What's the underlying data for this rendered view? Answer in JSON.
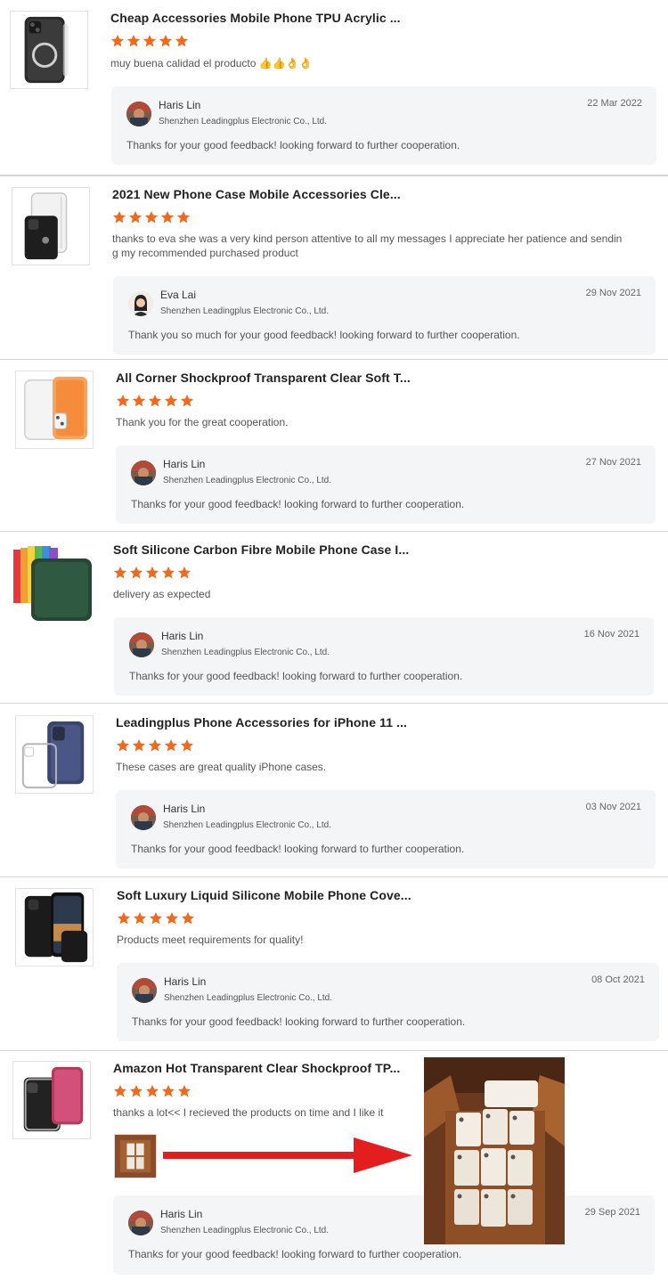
{
  "reviews": [
    {
      "title": "Cheap Accessories Mobile Phone TPU Acrylic ...",
      "comment": "muy buena calidad el producto 👍👍👌👌",
      "rating": 5,
      "reply": {
        "name": "Haris Lin",
        "company": "Shenzhen Leadingplus Electronic Co., Ltd.",
        "date": "22 Mar 2022",
        "text": "Thanks for your good feedback! looking forward to further cooperation."
      }
    },
    {
      "title": "2021 New Phone Case Mobile Accessories Cle...",
      "comment": "thanks to eva she was a very kind person attentive to all my messages I appreciate her patience and sendin g my recommended purchased product",
      "rating": 5,
      "reply": {
        "name": "Eva Lai",
        "company": "Shenzhen Leadingplus Electronic Co., Ltd.",
        "date": "29 Nov 2021",
        "text": "Thank you so much for your good feedback! looking forward to further cooperation."
      }
    },
    {
      "title": "All Corner Shockproof Transparent Clear Soft T...",
      "comment": "Thank you for the great cooperation.",
      "rating": 5,
      "reply": {
        "name": "Haris Lin",
        "company": "Shenzhen Leadingplus Electronic Co., Ltd.",
        "date": "27 Nov 2021",
        "text": "Thanks for your good feedback! looking forward to further cooperation."
      }
    },
    {
      "title": "Soft Silicone Carbon Fibre Mobile Phone Case I...",
      "comment": "delivery as expected",
      "rating": 5,
      "reply": {
        "name": "Haris Lin",
        "company": "Shenzhen Leadingplus Electronic Co., Ltd.",
        "date": "16 Nov 2021",
        "text": "Thanks for your good feedback! looking forward to further cooperation."
      }
    },
    {
      "title": "Leadingplus Phone Accessories for iPhone 11 ...",
      "comment": "These cases are great quality iPhone cases.",
      "rating": 5,
      "reply": {
        "name": "Haris Lin",
        "company": "Shenzhen Leadingplus Electronic Co., Ltd.",
        "date": "03 Nov 2021",
        "text": "Thanks for your good feedback! looking forward to further cooperation."
      }
    },
    {
      "title": "Soft Luxury Liquid Silicone Mobile Phone Cove...",
      "comment": "Products meet requirements for quality!",
      "rating": 5,
      "reply": {
        "name": "Haris Lin",
        "company": "Shenzhen Leadingplus Electronic Co., Ltd.",
        "date": "08 Oct 2021",
        "text": "Thanks for your good feedback! looking forward to further cooperation."
      }
    },
    {
      "title": "Amazon Hot Transparent Clear Shockproof TP...",
      "comment": "thanks a lot<< I recieved the products on time and I like it",
      "rating": 5,
      "reply": {
        "name": "Haris Lin",
        "company": "Shenzhen Leadingplus Electronic Co., Ltd.",
        "date": "29 Sep 2021",
        "text": "Thanks for your good feedback! looking forward to further cooperation."
      }
    }
  ],
  "colors": {
    "star": "#f06a1d",
    "reply_bg": "#f4f5f7",
    "arrow": "#e41e1e"
  }
}
